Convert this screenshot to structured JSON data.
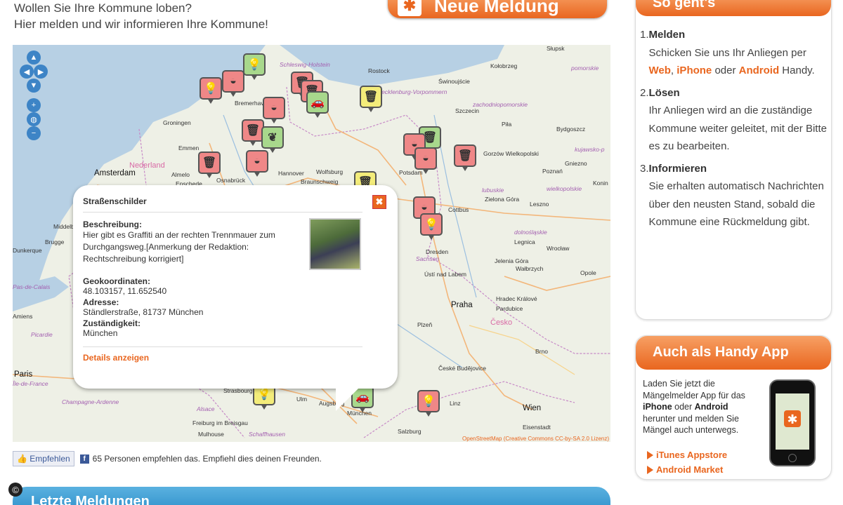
{
  "intro": {
    "line1": "Wollen Sie Ihre Kommune loben?",
    "line2": "Hier melden und wir informieren Ihre Kommune!"
  },
  "new_report_label": "Neue Meldung",
  "map": {
    "attribution": "OpenStreetMap (Creative Commons CC-by-SA 2.0 Lizenz)",
    "nav_icons": [
      "pan-up",
      "pan-left",
      "pan-right",
      "pan-down",
      "zoom-in",
      "globe",
      "zoom-out"
    ],
    "labels": [
      "Słupsk",
      "Kołobrzeg",
      "pomorskie",
      "Rostock",
      "Schleswig-Holstein",
      "Świnoujście",
      "Szczecin",
      "zachodniopomorskie",
      "Mecklenburg-Vorpommern",
      "Bremerhaven",
      "Groningen",
      "Emmen",
      "Piła",
      "Bydgoszcz",
      "kujawsko-p",
      "Gorzów Wielkopolski",
      "Amsterdam",
      "Almelo",
      "Enschede",
      "Nederland",
      "Osnabrück",
      "Hannover",
      "Wolfsburg",
      "Braunschweig",
      "Potsdam",
      "Poznań",
      "Gniezno",
      "Konin",
      "wielkopolskie",
      "lubuskie",
      "Zielona Góra",
      "Leszno",
      "Cottbus",
      "Middelburg",
      "Brugge",
      "Dunkerque",
      "Dresden",
      "Sachsen",
      "Legnica",
      "dolnośląskie",
      "Wrocław",
      "Jelenia Góra",
      "Wałbrzych",
      "Opole",
      "Ústí nad Labem",
      "Praha",
      "Hradec Králové",
      "Pardubice",
      "Česko",
      "Plzeň",
      "Amiens",
      "Picardie",
      "Paris",
      "Île-de-France",
      "Champagne-Ardenne",
      "Alsace",
      "Strasbourg",
      "Freiburg im Breisgau",
      "Mulhouse",
      "Schaffhausen",
      "Augsburg",
      "München",
      "Ulm",
      "Salzburg",
      "Linz",
      "Wien",
      "Eisenstadt",
      "České Budějovice",
      "Brno",
      "Pas-de-Calais"
    ],
    "marker_icons": [
      "lightbulb-icon",
      "trash-icon",
      "pothole-icon",
      "car-icon",
      "leaf-icon"
    ]
  },
  "popup": {
    "title": "Straßenschilder",
    "desc_label": "Beschreibung:",
    "desc": "Hier gibt es Graffiti an der rechten Trennmauer zum Durchgangsweg.[Anmerkung der Redaktion: Rechtschreibung korrigiert]",
    "geo_label": "Geokoordinaten:",
    "geo": "48.103157, 11.652540",
    "addr_label": "Adresse:",
    "addr": "Ständlerstraße, 81737 München",
    "resp_label": "Zuständigkeit:",
    "resp": "München",
    "details": "Details anzeigen",
    "close": "✖"
  },
  "social": {
    "like_button": "Empfehlen",
    "text": "65 Personen empfehlen das. Empfiehl dies deinen Freunden."
  },
  "latest_title": "Letzte Meldungen",
  "how_it_works": {
    "title": "So geht's",
    "steps": [
      {
        "num": "1.",
        "title": "Melden",
        "pre": "Schicken Sie uns Ihr Anliegen per ",
        "web": "Web",
        "comma": ", ",
        "iphone": "iPhone",
        "or": " oder ",
        "android": "Android",
        "post": " Handy."
      },
      {
        "num": "2.",
        "title": "Lösen",
        "body": "Ihr Anliegen wird an die zuständige Kommune weiter geleitet, mit der Bitte es zu bearbeiten."
      },
      {
        "num": "3.",
        "title": "Informieren",
        "body": "Sie erhalten automatisch Nachrichten über den neusten Stand, sobald die Kommune eine Rückmeldung gibt."
      }
    ]
  },
  "app_panel": {
    "title": "Auch als Handy App",
    "text_pre": "Laden Sie jetzt die Mängelmelder App für das ",
    "iphone": "iPhone",
    "oder": " oder ",
    "android": "Android",
    "text_post": " herunter und melden Sie Mängel auch unterwegs.",
    "links": [
      "iTunes Appstore",
      "Android Market"
    ]
  },
  "colors": {
    "accent": "#e9661f",
    "blue": "#2b8dc8"
  }
}
